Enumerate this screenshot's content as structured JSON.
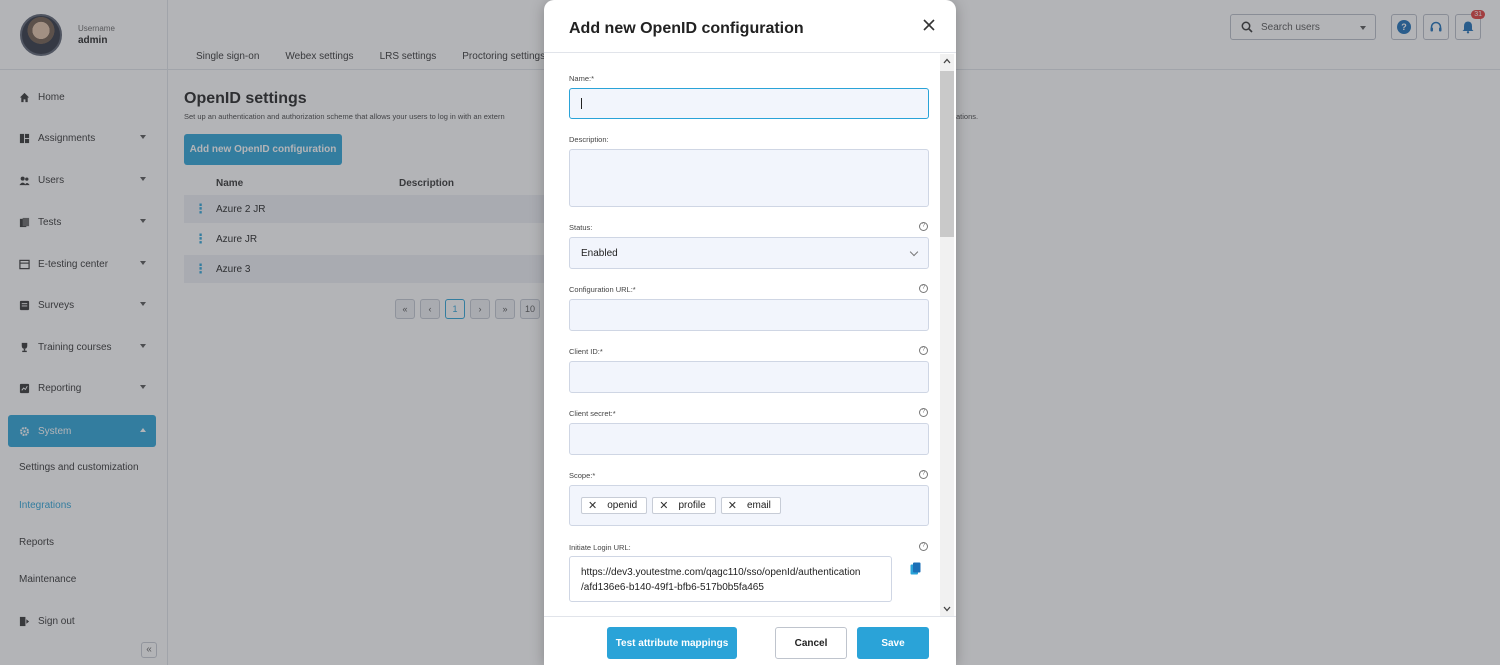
{
  "user": {
    "label": "Username",
    "name": "admin"
  },
  "sidebar": {
    "items": [
      {
        "label": "Home",
        "icon": "home-icon"
      },
      {
        "label": "Assignments",
        "icon": "assignments-icon"
      },
      {
        "label": "Users",
        "icon": "users-icon"
      },
      {
        "label": "Tests",
        "icon": "tests-icon"
      },
      {
        "label": "E-testing center",
        "icon": "testing-center-icon"
      },
      {
        "label": "Surveys",
        "icon": "surveys-icon"
      },
      {
        "label": "Training courses",
        "icon": "trophy-icon"
      },
      {
        "label": "Reporting",
        "icon": "reporting-icon"
      },
      {
        "label": "System",
        "icon": "gear-icon"
      }
    ],
    "sub_items": [
      "Settings and customization",
      "Integrations",
      "Reports",
      "Maintenance"
    ],
    "sign_out": "Sign out",
    "collapse": "«"
  },
  "topbar": {
    "tabs": [
      "Single sign-on",
      "Webex settings",
      "LRS settings",
      "Proctoring settings"
    ],
    "search_placeholder": "Search users",
    "help": "?",
    "notification_count": "31"
  },
  "main": {
    "title": "OpenID settings",
    "description": "Set up an authentication and authorization scheme that allows your users to log in with an extern",
    "description_tail": "ations.",
    "add_button": "Add new OpenID configuration",
    "columns": [
      "Name",
      "Description"
    ],
    "rows": [
      "Azure 2 JR",
      "Azure JR",
      "Azure 3"
    ],
    "pager": {
      "first": "«",
      "prev": "‹",
      "current": "1",
      "next": "›",
      "last": "»",
      "page_size": "10"
    }
  },
  "modal": {
    "title": "Add new OpenID configuration",
    "fields": {
      "name_label": "Name:*",
      "description_label": "Description:",
      "status_label": "Status:",
      "status_value": "Enabled",
      "config_url_label": "Configuration URL:*",
      "client_id_label": "Client ID:*",
      "client_secret_label": "Client secret:*",
      "scope_label": "Scope:*",
      "scope_chips": [
        "openid",
        "profile",
        "email"
      ],
      "login_url_label": "Initiate Login URL:",
      "login_url_line1": "https://dev3.youtestme.com/qagc110/sso/openId/authentication",
      "login_url_line2": "/afd136e6-b140-49f1-bfb6-517b0b5fa465"
    },
    "help_glyph": "?",
    "chip_remove": "✕",
    "buttons": {
      "test": "Test attribute mappings",
      "cancel": "Cancel",
      "save": "Save"
    }
  },
  "colors": {
    "accent": "#2aa3d8",
    "notification": "#e23b3b",
    "help": "#1b6fb7"
  }
}
